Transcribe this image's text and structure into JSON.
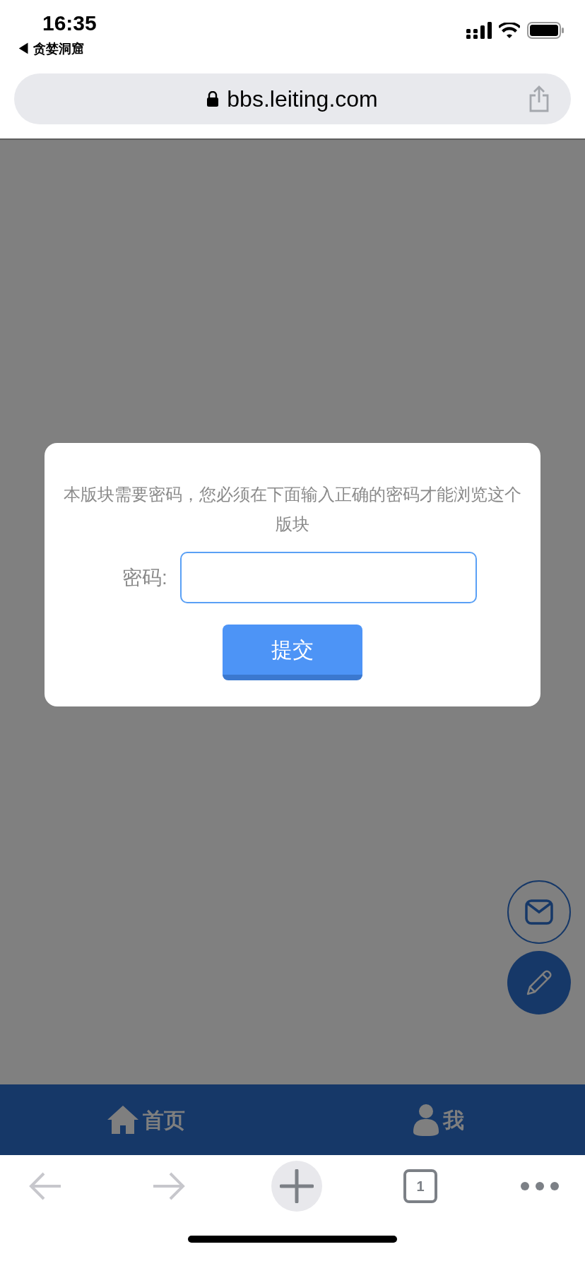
{
  "status_bar": {
    "time": "16:35",
    "back_link": "◀ 贪婪洞窟"
  },
  "address_bar": {
    "url": "bbs.leiting.com"
  },
  "dialog": {
    "message": "本版块需要密码，您必须在下面输入正确的密码才能浏览这个版块",
    "password_label": "密码:",
    "submit": "提交"
  },
  "bottom_nav": [
    {
      "kind": "home",
      "label": "首页"
    },
    {
      "kind": "profile",
      "label": "我"
    }
  ],
  "browser_toolbar": [
    {
      "kind": "back",
      "disabled": true
    },
    {
      "kind": "forward",
      "disabled": true
    },
    {
      "kind": "new",
      "disabled": false
    },
    {
      "kind": "tabs",
      "label": "1",
      "disabled": false
    },
    {
      "kind": "more",
      "disabled": false
    }
  ]
}
